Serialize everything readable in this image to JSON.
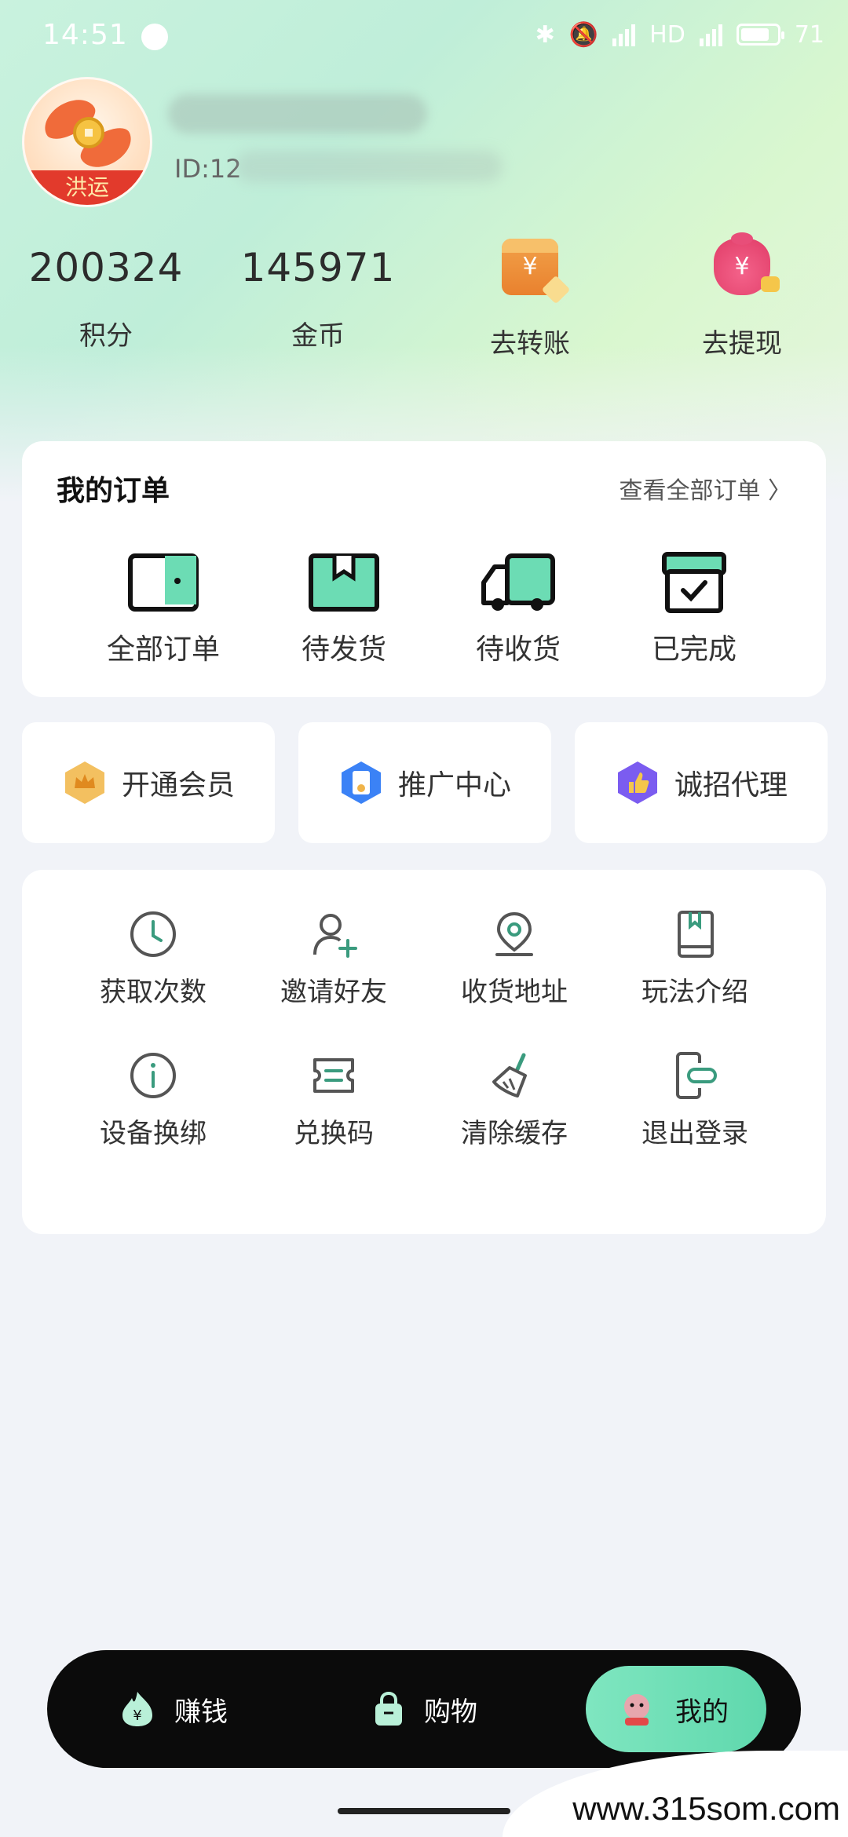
{
  "status_bar": {
    "time": "14:51",
    "net": "HD",
    "battery": "71"
  },
  "profile": {
    "avatar_badge": "洪运",
    "id_prefix": "ID:12"
  },
  "stats": [
    {
      "value": "200324",
      "label": "积分"
    },
    {
      "value": "145971",
      "label": "金币"
    }
  ],
  "actions": [
    {
      "label": "去转账",
      "icon": "transfer-wallet-icon",
      "glyph": "¥"
    },
    {
      "label": "去提现",
      "icon": "money-bag-icon",
      "glyph": "¥"
    }
  ],
  "orders": {
    "title": "我的订单",
    "view_all": "查看全部订单 〉",
    "items": [
      {
        "label": "全部订单",
        "icon": "wallet-icon"
      },
      {
        "label": "待发货",
        "icon": "box-icon"
      },
      {
        "label": "待收货",
        "icon": "truck-icon"
      },
      {
        "label": "已完成",
        "icon": "completed-box-icon"
      }
    ]
  },
  "quick_links": [
    {
      "label": "开通会员",
      "icon": "crown-badge-icon",
      "color": "#f0b44a"
    },
    {
      "label": "推广中心",
      "icon": "promo-badge-icon",
      "color": "#3b82f6"
    },
    {
      "label": "诚招代理",
      "icon": "thumbs-up-badge-icon",
      "color": "#7b5cf0"
    }
  ],
  "services": [
    {
      "label": "获取次数",
      "icon": "clock-icon"
    },
    {
      "label": "邀请好友",
      "icon": "invite-user-icon"
    },
    {
      "label": "收货地址",
      "icon": "location-pin-icon"
    },
    {
      "label": "玩法介绍",
      "icon": "book-icon"
    },
    {
      "label": "设备换绑",
      "icon": "info-icon"
    },
    {
      "label": "兑换码",
      "icon": "ticket-icon"
    },
    {
      "label": "清除缓存",
      "icon": "broom-icon"
    },
    {
      "label": "退出登录",
      "icon": "logout-icon"
    }
  ],
  "bottom_nav": [
    {
      "label": "赚钱",
      "icon": "fire-coin-icon",
      "glyph": "¥"
    },
    {
      "label": "购物",
      "icon": "shopping-bag-icon"
    },
    {
      "label": "我的",
      "icon": "profile-face-icon",
      "active": true
    }
  ],
  "watermark": "www.315som.com",
  "colors": {
    "accent": "#3a9b7e",
    "active_tab": "#6cdcb4",
    "nav_bg": "#0b0b0b"
  }
}
